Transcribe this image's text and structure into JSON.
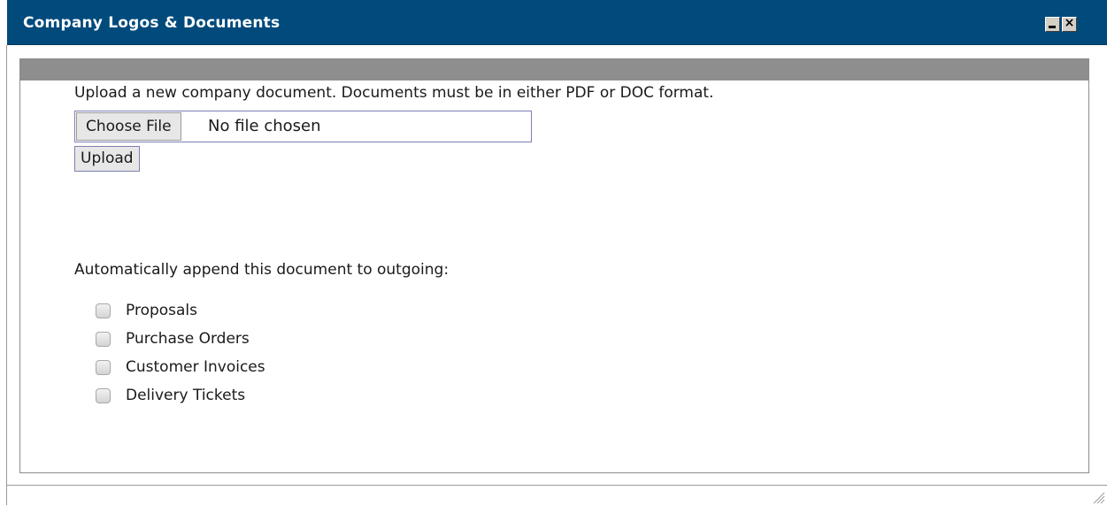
{
  "window": {
    "title": "Company Logos & Documents",
    "colors": {
      "titlebar": "#004a7c",
      "panel_header": "#8e8e8e"
    }
  },
  "upload": {
    "instructions": "Upload a new company document. Documents must be in either PDF or DOC format.",
    "choose_file_label": "Choose File",
    "file_status": "No file chosen",
    "upload_label": "Upload"
  },
  "append": {
    "label": "Automatically append this document to outgoing:",
    "options": [
      {
        "label": "Proposals",
        "checked": false
      },
      {
        "label": "Purchase Orders",
        "checked": false
      },
      {
        "label": "Customer Invoices",
        "checked": false
      },
      {
        "label": "Delivery Tickets",
        "checked": false
      }
    ]
  },
  "icons": {
    "minimize": "minimize-icon",
    "close": "close-icon",
    "resize": "resize-grip-icon"
  }
}
